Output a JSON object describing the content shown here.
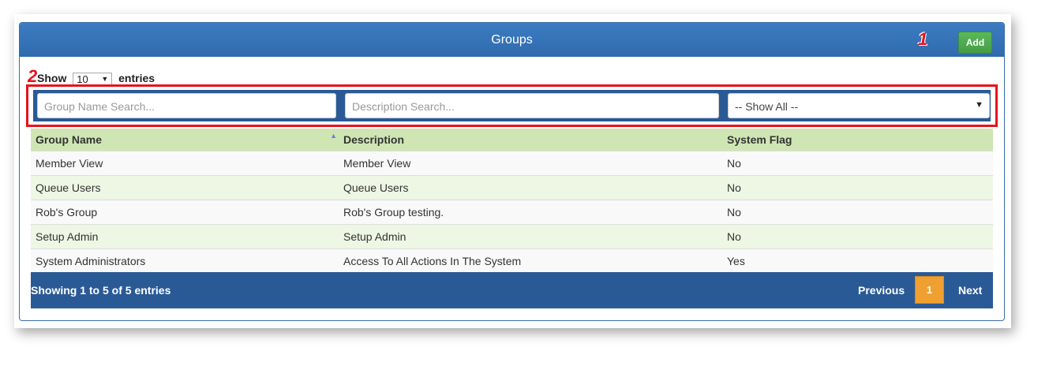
{
  "panel": {
    "title": "Groups",
    "add_label": "Add"
  },
  "callouts": {
    "one": "1",
    "two": "2"
  },
  "length": {
    "prefix": "Show",
    "value": "10",
    "suffix": "entries"
  },
  "filters": {
    "group_name_placeholder": "Group Name Search...",
    "description_placeholder": "Description Search...",
    "system_flag_selected": "-- Show All --"
  },
  "table": {
    "columns": [
      "Group Name",
      "Description",
      "System Flag"
    ],
    "rows": [
      [
        "Member View",
        "Member View",
        "No"
      ],
      [
        "Queue Users",
        "Queue Users",
        "No"
      ],
      [
        "Rob's Group",
        "Rob's Group testing.",
        "No"
      ],
      [
        "Setup Admin",
        "Setup Admin",
        "No"
      ],
      [
        "System Administrators",
        "Access To All Actions In The System",
        "Yes"
      ]
    ]
  },
  "footer": {
    "info": "Showing 1 to 5 of 5 entries",
    "previous": "Previous",
    "current_page": "1",
    "next": "Next"
  },
  "icons": {
    "sort": "sort-ascending-icon",
    "dropdown": "chevron-down-icon"
  }
}
